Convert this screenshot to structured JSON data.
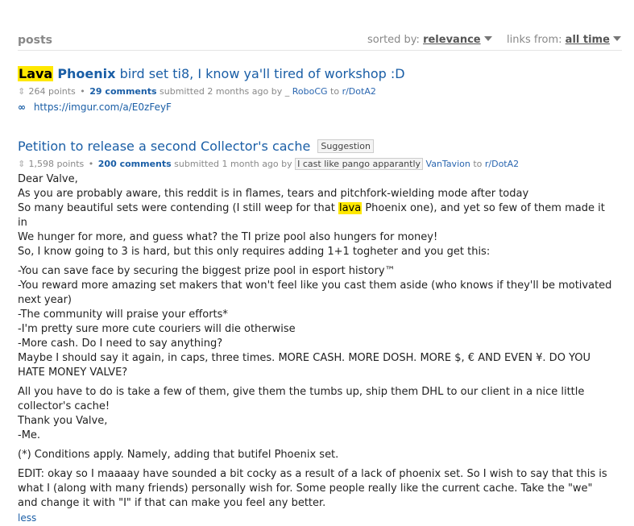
{
  "header": {
    "title": "posts",
    "sorted_by_label": "sorted by:",
    "sorted_by_value": "relevance",
    "links_from_label": "links from:",
    "links_from_value": "all time"
  },
  "posts": [
    {
      "title_hl": "Lava",
      "title_word2": "Phoenix",
      "title_rest": "bird set ti8, I know ya'll tired of workshop :D",
      "points": "264 points",
      "comments": "29 comments",
      "submitted": "submitted 2 months ago by",
      "author_prefix": "_",
      "author": "RoboCG",
      "to_label": "to",
      "subreddit": "r/DotA2",
      "url": "https://imgur.com/a/E0zFeyF"
    },
    {
      "title": "Petition to release a second Collector's cache",
      "flair": "Suggestion",
      "points": "1,598 points",
      "comments": "200 comments",
      "submitted": "submitted 1 month ago by",
      "user_flair": "I cast like pango apparantly",
      "author": "VanTavion",
      "to_label": "to",
      "subreddit": "r/DotA2",
      "body": {
        "l1": "Dear Valve,",
        "l2": "As you are probably aware, this reddit is in flames, tears and pitchfork-wielding mode after today",
        "l3a": "So many beautiful sets were contending (I still weep for that",
        "l3hl": "lava",
        "l3b": "Phoenix one), and yet so few of them made it in",
        "l4": "We hunger for more, and guess what? the TI prize pool also hungers for money!",
        "l5": "So, I know going to 3 is hard, but this only requires adding 1+1 togheter and you get this:",
        "b1": "-You can save face by securing the biggest prize pool in esport history™",
        "b2": "-You reward more amazing set makers that won't feel like you cast them aside (who knows if they'll be motivated next year)",
        "b3": "-The community will praise your efforts*",
        "b4": "-I'm pretty sure more cute couriers will die otherwise",
        "b5": "-More cash. Do I need to say anything?",
        "b6": "Maybe I should say it again, in caps, three times. MORE CASH. MORE DOSH. MORE $, € AND EVEN ¥. DO YOU HATE MONEY VALVE?",
        "c1": "All you have to do is take a few of them, give them the tumbs up, ship them DHL to our client in a nice little collector's cache!",
        "c2": "Thank you Valve,",
        "c3": "-Me.",
        "d1": "(*) Conditions apply. Namely, adding that butifel Phoenix set.",
        "e1": "EDIT: okay so I maaaay have sounded a bit cocky as a result of a lack of phoenix set. So I wish to say that this is what I (along with many friends) personally wish for. Some people really like the current cache. Take the \"we\" and change it with \"I\" if that can make you feel any better.",
        "less": "less"
      }
    }
  ],
  "icons": {
    "vote": "vote-arrows-icon",
    "link": "link-icon",
    "caret": "caret-down-icon"
  }
}
